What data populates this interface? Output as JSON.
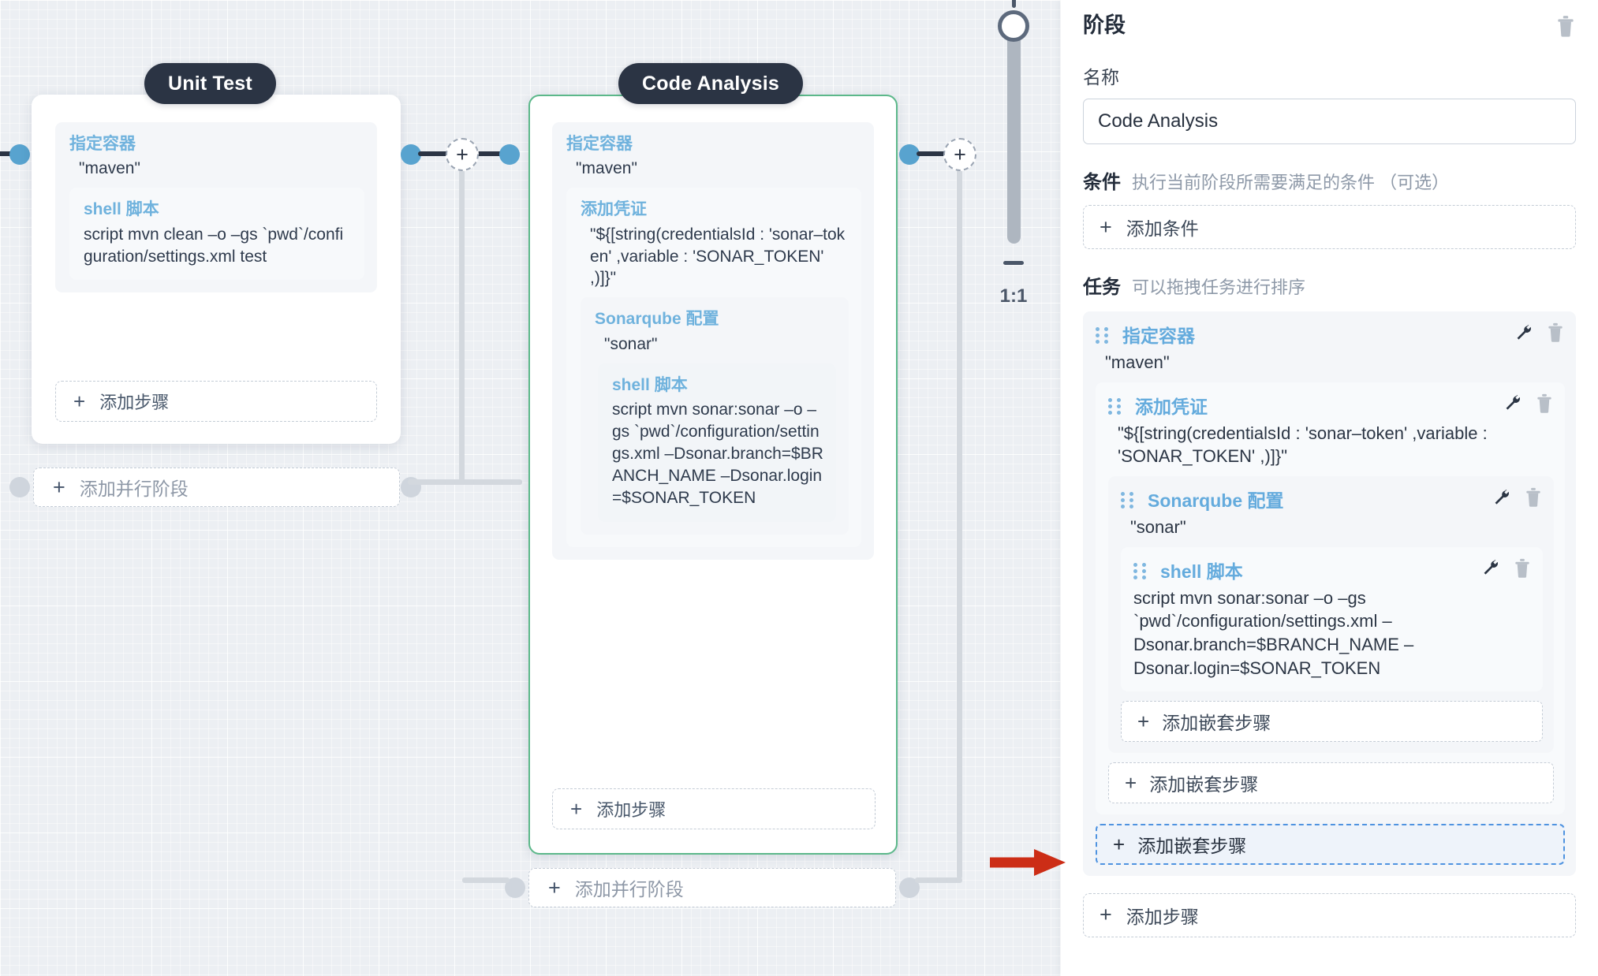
{
  "canvas": {
    "zoom_control": {
      "ratio_label": "1:1",
      "plus_icon": "plus-icon",
      "minus_icon": "minus-icon"
    },
    "stages": [
      {
        "id": "unit-test",
        "title": "Unit Test",
        "selected": false,
        "steps": [
          {
            "name": "指定容器",
            "value": "\"maven\"",
            "children": [
              {
                "name": "shell 脚本",
                "value": "script   mvn clean –o –gs `pwd`/configuration/settings.xml test",
                "children": []
              }
            ]
          }
        ],
        "add_step_label": "添加步骤",
        "add_parallel_label": "添加并行阶段"
      },
      {
        "id": "code-analysis",
        "title": "Code Analysis",
        "selected": true,
        "steps": [
          {
            "name": "指定容器",
            "value": "\"maven\"",
            "children": [
              {
                "name": "添加凭证",
                "value": "\"${[string(credentialsId : 'sonar–token' ,variable : 'SONAR_TOKEN' ,)]}\"",
                "children": [
                  {
                    "name": "Sonarqube 配置",
                    "value": "\"sonar\"",
                    "children": [
                      {
                        "name": "shell 脚本",
                        "value": "script   mvn sonar:sonar –o –gs `pwd`/configuration/settings.xml –Dsonar.branch=$BRANCH_NAME –Dsonar.login=$SONAR_TOKEN",
                        "children": []
                      }
                    ]
                  }
                ]
              }
            ]
          }
        ],
        "add_step_label": "添加步骤",
        "add_parallel_label": "添加并行阶段"
      }
    ]
  },
  "panel": {
    "title": "阶段",
    "delete_icon": "trash-icon",
    "name_label": "名称",
    "name_value": "Code Analysis",
    "condition": {
      "label": "条件",
      "hint": "执行当前阶段所需要满足的条件 （可选）",
      "add_label": "添加条件"
    },
    "tasks": {
      "label": "任务",
      "hint": "可以拖拽任务进行排序",
      "tree": {
        "name": "指定容器",
        "value": "\"maven\"",
        "grip_icon": "drag-handle-icon",
        "wrench_icon": "wrench-icon",
        "trash_icon": "trash-icon",
        "child": {
          "name": "添加凭证",
          "value": "\"${[string(credentialsId : 'sonar–token' ,variable : 'SONAR_TOKEN' ,)]}\"",
          "child": {
            "name": "Sonarqube 配置",
            "value": "\"sonar\"",
            "child": {
              "name": "shell 脚本",
              "value": "script   mvn sonar:sonar –o –gs `pwd`/configuration/settings.xml –Dsonar.branch=$BRANCH_NAME –Dsonar.login=$SONAR_TOKEN"
            }
          }
        }
      },
      "add_nested_label": "添加嵌套步骤",
      "add_step_label": "添加步骤"
    },
    "highlight_color": "#4f93e0",
    "arrow_color": "#cc2d16"
  }
}
